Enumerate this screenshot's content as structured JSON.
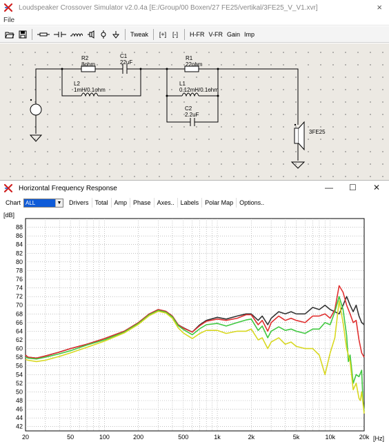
{
  "app": {
    "title": "Loudspeaker Crossover Simulator v2.0.4a [E:/Group/00 Boxen/27 FE25/vertikal/3FE25_V_V1.xvr]",
    "close_glyph": "×"
  },
  "menu": {
    "file_label": "File"
  },
  "toolbar": {
    "tweak_label": "Tweak",
    "plus_label": "[+]",
    "minus_label": "[-]",
    "hfr_label": "H-FR",
    "vfr_label": "V-FR",
    "gain_label": "Gain",
    "imp_label": "Imp"
  },
  "schematic": {
    "r2_name": "R2",
    "r2_value": "8ohm",
    "c1_name": "C1",
    "c1_value": "22uF",
    "l2_name": "L2",
    "l2_value": "1mH/0.1ohm",
    "r1_name": "R1",
    "r1_value": "22ohm",
    "l1_name": "L1",
    "l1_value": "0.12mH/0.1ohm",
    "c2_name": "C2",
    "c2_value": "2.2uF",
    "driver_name": "3FE25"
  },
  "fr_window": {
    "title": "Horizontal Frequency Response",
    "minimize_glyph": "—",
    "maximize_glyph": "☐",
    "close_glyph": "✕",
    "chart_label": "Chart",
    "chart_value": "ALL",
    "drivers_label": "Drivers",
    "total_label": "Total",
    "amp_label": "Amp",
    "phase_label": "Phase",
    "axes_label": "Axes..",
    "labels_label": "Labels",
    "polar_label": "Polar Map",
    "options_label": "Options.."
  },
  "chart_data": {
    "type": "line",
    "title": "",
    "xlabel": "[Hz]",
    "ylabel": "[dB]",
    "x_scale": "log",
    "xlim": [
      20,
      20000
    ],
    "ylim": [
      41,
      90
    ],
    "y_ticks": [
      42,
      44,
      46,
      48,
      50,
      52,
      54,
      56,
      58,
      60,
      62,
      64,
      66,
      68,
      70,
      72,
      74,
      76,
      78,
      80,
      82,
      84,
      86,
      88
    ],
    "x_ticks": [
      20,
      50,
      100,
      200,
      500,
      1000,
      2000,
      5000,
      10000,
      20000
    ],
    "x_tick_labels": [
      "20",
      "50",
      "100",
      "200",
      "500",
      "1k",
      "2k",
      "5k",
      "10k",
      "20k"
    ],
    "grid": true,
    "series": [
      {
        "color": "#333333",
        "x": [
          20,
          21,
          25,
          30,
          40,
          50,
          70,
          100,
          150,
          200,
          250,
          300,
          350,
          400,
          450,
          500,
          600,
          700,
          800,
          1000,
          1200,
          1500,
          1800,
          2000,
          2300,
          2500,
          2800,
          3000,
          3500,
          4000,
          4500,
          5000,
          6000,
          7000,
          8000,
          9000,
          10000,
          11000,
          12000,
          13000,
          14000,
          15000,
          16000,
          17000,
          18000,
          19000,
          20000
        ],
        "y": [
          58.5,
          58.0,
          57.8,
          58.3,
          59.2,
          60.0,
          61.0,
          62.3,
          64.0,
          66.0,
          68.0,
          69.0,
          68.6,
          67.5,
          65.5,
          64.8,
          63.8,
          65.5,
          66.5,
          67.2,
          66.8,
          67.5,
          68.0,
          68.0,
          66.5,
          67.5,
          65.5,
          67.0,
          68.5,
          68.0,
          68.5,
          68.0,
          68.0,
          69.5,
          69.0,
          70.0,
          69.0,
          68.5,
          68.0,
          70.0,
          72.0,
          70.0,
          68.5,
          70.0,
          67.5,
          66.0,
          65.5
        ]
      },
      {
        "color": "#e03030",
        "x": [
          20,
          21,
          25,
          30,
          40,
          50,
          70,
          100,
          150,
          200,
          250,
          300,
          350,
          400,
          450,
          500,
          600,
          700,
          800,
          1000,
          1200,
          1500,
          1800,
          2000,
          2300,
          2500,
          2800,
          3000,
          3500,
          4000,
          4500,
          5000,
          6000,
          7000,
          8000,
          9000,
          10000,
          11000,
          12000,
          13000,
          14000,
          15000,
          16000,
          17000,
          18000,
          19000,
          20000
        ],
        "y": [
          58.5,
          58.0,
          57.8,
          58.3,
          59.2,
          60.0,
          61.0,
          62.3,
          64.0,
          66.0,
          68.0,
          69.0,
          68.6,
          67.5,
          65.5,
          64.7,
          63.8,
          65.3,
          66.3,
          66.8,
          66.5,
          67.0,
          67.8,
          67.8,
          65.5,
          66.5,
          64.0,
          66.0,
          67.5,
          66.5,
          67.0,
          66.5,
          66.0,
          67.5,
          67.5,
          68.0,
          67.0,
          69.0,
          74.5,
          73.0,
          70.0,
          68.0,
          66.0,
          66.5,
          62.0,
          59.0,
          58.0
        ]
      },
      {
        "color": "#40c840",
        "x": [
          20,
          21,
          25,
          30,
          40,
          50,
          70,
          100,
          150,
          200,
          250,
          300,
          350,
          400,
          450,
          500,
          600,
          700,
          800,
          1000,
          1200,
          1500,
          1800,
          2000,
          2300,
          2500,
          2800,
          3000,
          3500,
          4000,
          4500,
          5000,
          6000,
          7000,
          8000,
          9000,
          10000,
          11000,
          12000,
          13000,
          14000,
          14500,
          15000,
          16000,
          17000,
          18000,
          19000,
          19500,
          20000
        ],
        "y": [
          58.0,
          57.8,
          57.6,
          58.0,
          58.8,
          59.5,
          60.8,
          62.0,
          63.8,
          65.8,
          67.8,
          68.8,
          68.4,
          67.3,
          65.3,
          64.4,
          63.2,
          64.6,
          65.5,
          65.8,
          65.2,
          66.0,
          66.6,
          66.8,
          64.2,
          65.2,
          62.5,
          64.0,
          65.0,
          64.2,
          64.5,
          64.0,
          63.5,
          64.5,
          64.5,
          66.0,
          65.5,
          68.5,
          72.0,
          69.0,
          63.0,
          57.0,
          58.5,
          52.0,
          54.0,
          53.5,
          55.0,
          48.0,
          45.5
        ]
      },
      {
        "color": "#d8d820",
        "x": [
          20,
          21,
          25,
          30,
          40,
          50,
          70,
          100,
          150,
          200,
          250,
          300,
          350,
          400,
          450,
          500,
          600,
          700,
          800,
          1000,
          1200,
          1500,
          1800,
          2000,
          2300,
          2500,
          2800,
          3000,
          3500,
          4000,
          4500,
          5000,
          6000,
          7000,
          8000,
          9000,
          10000,
          11000,
          12000,
          13000,
          14000,
          15000,
          16000,
          17000,
          18000,
          18500,
          19000,
          20000
        ],
        "y": [
          57.5,
          57.3,
          57.0,
          57.3,
          58.2,
          59.0,
          60.3,
          61.7,
          63.6,
          65.6,
          67.6,
          68.6,
          68.2,
          67.0,
          64.8,
          63.6,
          62.3,
          63.5,
          64.2,
          64.2,
          63.5,
          64.0,
          64.0,
          64.5,
          62.0,
          62.5,
          60.0,
          61.5,
          62.5,
          61.0,
          61.5,
          60.5,
          60.0,
          60.0,
          58.5,
          54.0,
          59.0,
          62.5,
          71.0,
          66.0,
          60.0,
          57.0,
          50.5,
          52.0,
          48.5,
          48.0,
          50.0,
          45.0
        ]
      }
    ]
  }
}
